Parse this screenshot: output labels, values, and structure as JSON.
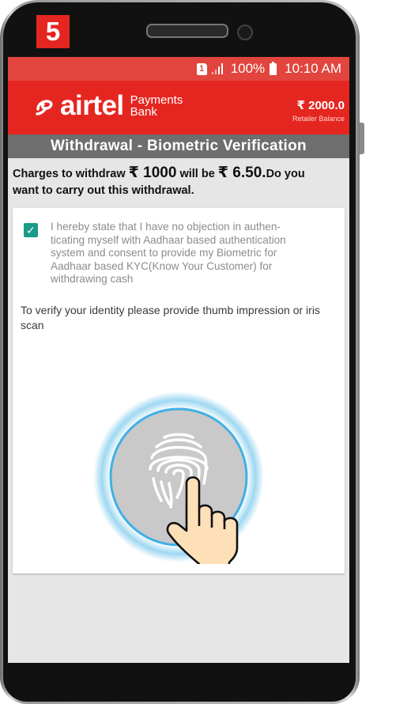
{
  "step_number": "5",
  "status_bar": {
    "sim_slot": "1",
    "battery": "100%",
    "time": "10:10 AM"
  },
  "app_bar": {
    "brand": "airtel",
    "brand_sub_line1": "Payments",
    "brand_sub_line2": "Bank",
    "balance_amount": "₹ 2000.0",
    "balance_label": "Retailer Balance"
  },
  "page_title": "Withdrawal - Biometric Verification",
  "charges": {
    "prefix": "Charges to withdraw ",
    "amount": "₹ 1000",
    "middle": " will be ",
    "fee": "₹ 6.50.",
    "suffix_line1": "Do you",
    "line2": "want to carry out this withdrawal."
  },
  "consent": {
    "checked": true,
    "lines": [
      "I hereby state that I have no objection in authen-",
      "ticating myself with Aadhaar based authentication",
      "system and consent to provide my Biometric for",
      "Aadhaar based KYC(Know Your Customer) for",
      "withdrawing cash"
    ]
  },
  "verify_text": "To verify your identity please provide thumb impression or iris scan",
  "scanner_icon": "fingerprint-touch-icon",
  "colors": {
    "brand_red": "#e52620",
    "status_red": "#e1453d",
    "title_gray": "#6e6e6e",
    "checkbox_teal": "#1a9b8a",
    "scanner_glow": "#29a8e0"
  }
}
